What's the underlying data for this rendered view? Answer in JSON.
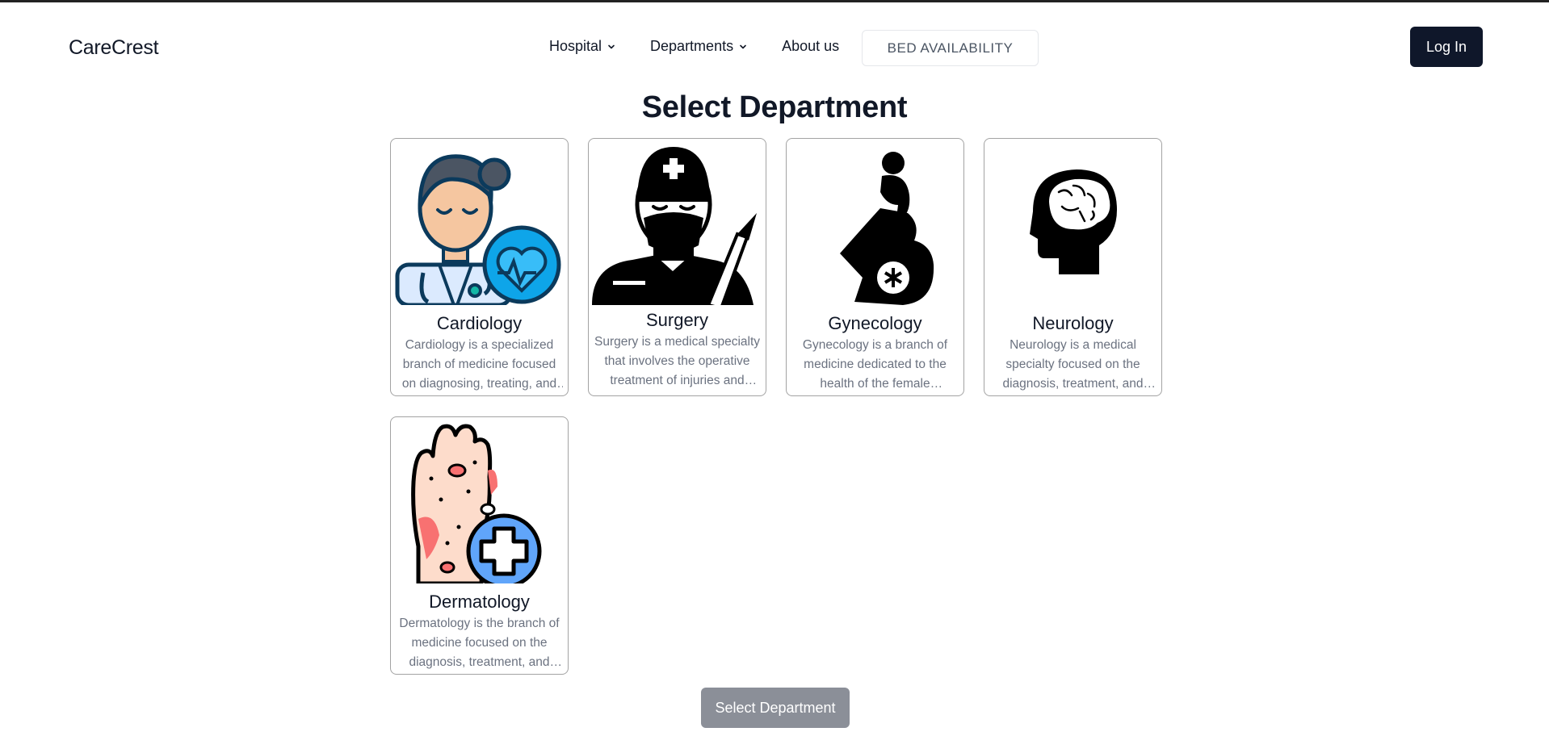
{
  "brand": {
    "name": "CareCrest"
  },
  "nav": {
    "items": [
      {
        "label": "Hospital",
        "dropdown": true
      },
      {
        "label": "Departments",
        "dropdown": true
      },
      {
        "label": "About us",
        "dropdown": false
      }
    ],
    "bed_availability": "BED AVAILABILITY",
    "login": "Log In"
  },
  "page": {
    "title": "Select Department"
  },
  "departments": [
    {
      "name": "Cardiology",
      "description": "Cardiology is a specialized branch of medicine focused on diagnosing, treating, and preventing diseases of the heart.",
      "icon": "cardiologist-doctor-icon"
    },
    {
      "name": "Surgery",
      "description": "Surgery is a medical specialty that involves the operative treatment of injuries and diseases.",
      "icon": "surgeon-icon"
    },
    {
      "name": "Gynecology",
      "description": "Gynecology is a branch of medicine dedicated to the health of the female reproductive system.",
      "icon": "pregnant-woman-icon"
    },
    {
      "name": "Neurology",
      "description": "Neurology is a medical specialty focused on the diagnosis, treatment, and management of nervous system disorders.",
      "icon": "brain-head-icon"
    },
    {
      "name": "Dermatology",
      "description": "Dermatology is the branch of medicine focused on the diagnosis, treatment, and prevention of skin conditions.",
      "icon": "skin-hand-icon"
    }
  ],
  "actions": {
    "select_department": "Select Department"
  },
  "colors": {
    "primary_dark": "#0f172a",
    "disabled_button": "#8b8f98",
    "muted_text": "#6b7280"
  }
}
